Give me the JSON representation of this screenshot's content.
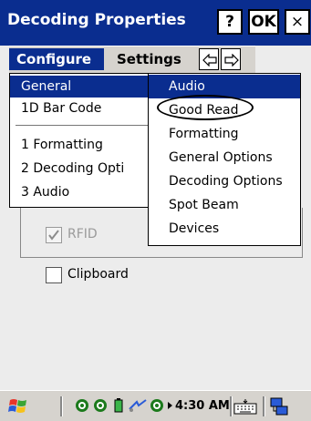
{
  "title_bar": {
    "title": "Decoding Properties",
    "help_label": "?",
    "ok_label": "OK",
    "close_label": "×"
  },
  "menu_bar": {
    "configure_label": "Configure",
    "settings_label": "Settings"
  },
  "configure_menu": {
    "items": [
      {
        "label": "General",
        "active": true
      },
      {
        "label": "1D Bar Code",
        "active": false
      },
      {
        "label": "1 Formatting",
        "active": false
      },
      {
        "label": "2 Decoding Opti",
        "active": false
      },
      {
        "label": "3 Audio",
        "active": false
      }
    ]
  },
  "settings_submenu": {
    "items": [
      {
        "label": "Audio",
        "active": true
      },
      {
        "label": "Good Read",
        "active": false
      },
      {
        "label": "Formatting",
        "active": false
      },
      {
        "label": "General Options",
        "active": false
      },
      {
        "label": "Decoding Options",
        "active": false
      },
      {
        "label": "Spot Beam",
        "active": false
      },
      {
        "label": "Devices",
        "active": false
      }
    ]
  },
  "page": {
    "rfid_label": "RFID",
    "rfid_checked": true,
    "rfid_enabled": false,
    "clipboard_label": "Clipboard",
    "clipboard_checked": false
  },
  "taskbar": {
    "time": "4:30 AM"
  },
  "colors": {
    "accent": "#0a2d8f",
    "panel": "#d6d3ce",
    "background": "#ececec"
  }
}
